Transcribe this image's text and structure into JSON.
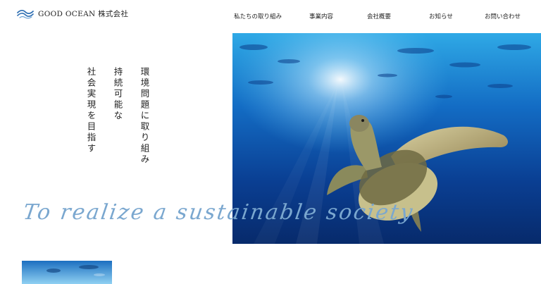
{
  "header": {
    "logo_text": "GOOD OCEAN 株式会社",
    "nav": [
      {
        "label": "私たちの取り組み"
      },
      {
        "label": "事業内容"
      },
      {
        "label": "会社概要"
      },
      {
        "label": "お知らせ"
      },
      {
        "label": "お問い合わせ"
      }
    ]
  },
  "hero": {
    "headline_lines": [
      "環境問題に取り組み",
      "持続可能な",
      "社会実現を目指す"
    ],
    "tagline": "To realize a sustainable society"
  },
  "colors": {
    "accent": "#7aa7cf",
    "logo_blue": "#2f6fb3",
    "ocean_deep": "#0a2a6b"
  },
  "icons": {
    "logo": "wave-logo-icon"
  }
}
